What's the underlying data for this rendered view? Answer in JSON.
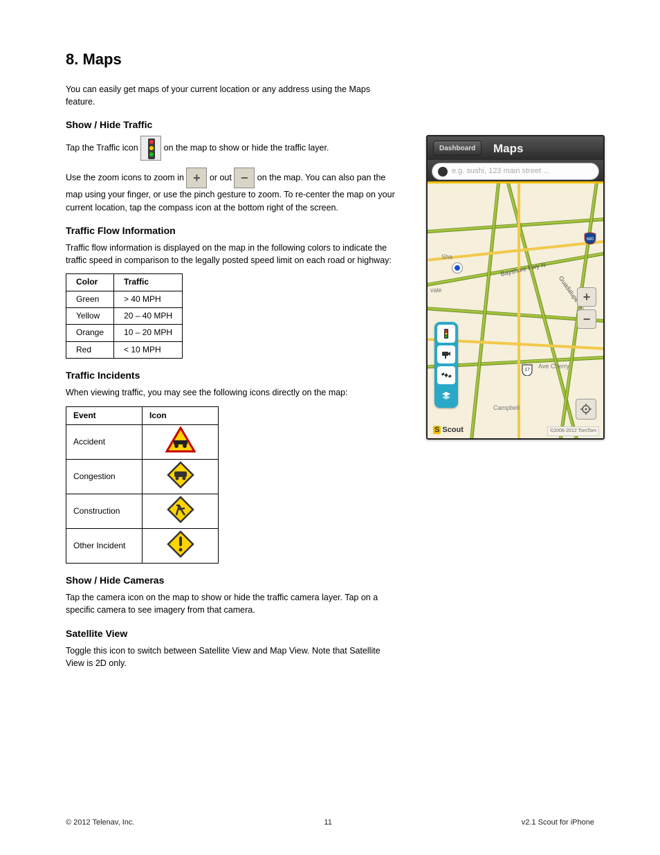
{
  "footer": {
    "copyright": "© 2012 Telenav, Inc.",
    "page": "11",
    "version": "v2.1 Scout for iPhone"
  },
  "title": "8. Maps",
  "intro": "You can easily get maps of your current location or any address using the Maps feature.",
  "sec_traffic": {
    "heading": "Show / Hide Traffic",
    "p1a": "Tap the Traffic icon ",
    "p1b": " on the map to show or hide the traffic layer.",
    "p2a": "Use the zoom icons to zoom in ",
    "p2b": " or out ",
    "p2c": " on the map. You can also pan the map using your finger, or use the pinch gesture to zoom. To re-center the map on your current location, tap the compass icon at the bottom right of the screen."
  },
  "sec_flow": {
    "heading": "Traffic Flow Information",
    "p": "Traffic flow information is displayed on the map in the following colors to indicate the traffic speed in comparison to the legally posted speed limit on each road or highway:",
    "table": {
      "h1": "Color",
      "h2": "Traffic",
      "rows": [
        [
          "Green",
          "> 40 MPH"
        ],
        [
          "Yellow",
          "20 – 40 MPH"
        ],
        [
          "Orange",
          "10 – 20 MPH"
        ],
        [
          "Red",
          "< 10 MPH"
        ]
      ]
    }
  },
  "sec_inc": {
    "heading": "Traffic Incidents",
    "p": "When viewing traffic, you may see the following icons directly on the map:",
    "table": {
      "h1": "Event",
      "h2": "Icon",
      "rows": [
        "Accident",
        "Congestion",
        "Construction",
        "Other Incident"
      ]
    }
  },
  "sec_cam": {
    "heading": "Show / Hide Cameras",
    "p": "Tap the camera icon on the map to show or hide the traffic camera layer. Tap on a specific camera to see imagery from that camera."
  },
  "sec_sat": {
    "heading": "Satellite View",
    "p": "Toggle this icon to switch between Satellite View and Map View. Note that Satellite View is 2D only."
  },
  "phone": {
    "dashboard": "Dashboard",
    "title": "Maps",
    "placeholder": "e.g. sushi, 123 main street ...",
    "scout": "Scout",
    "tomtom": "©2006-2012 TomTom",
    "road1": "Bayshore Fwy N",
    "road2": "Guadalupe Pkwy N",
    "city1": "vale",
    "city2": "Sha",
    "city3": "Campbell",
    "city4": "Ave Cherry",
    "shield1": "680",
    "shield2": "17"
  }
}
